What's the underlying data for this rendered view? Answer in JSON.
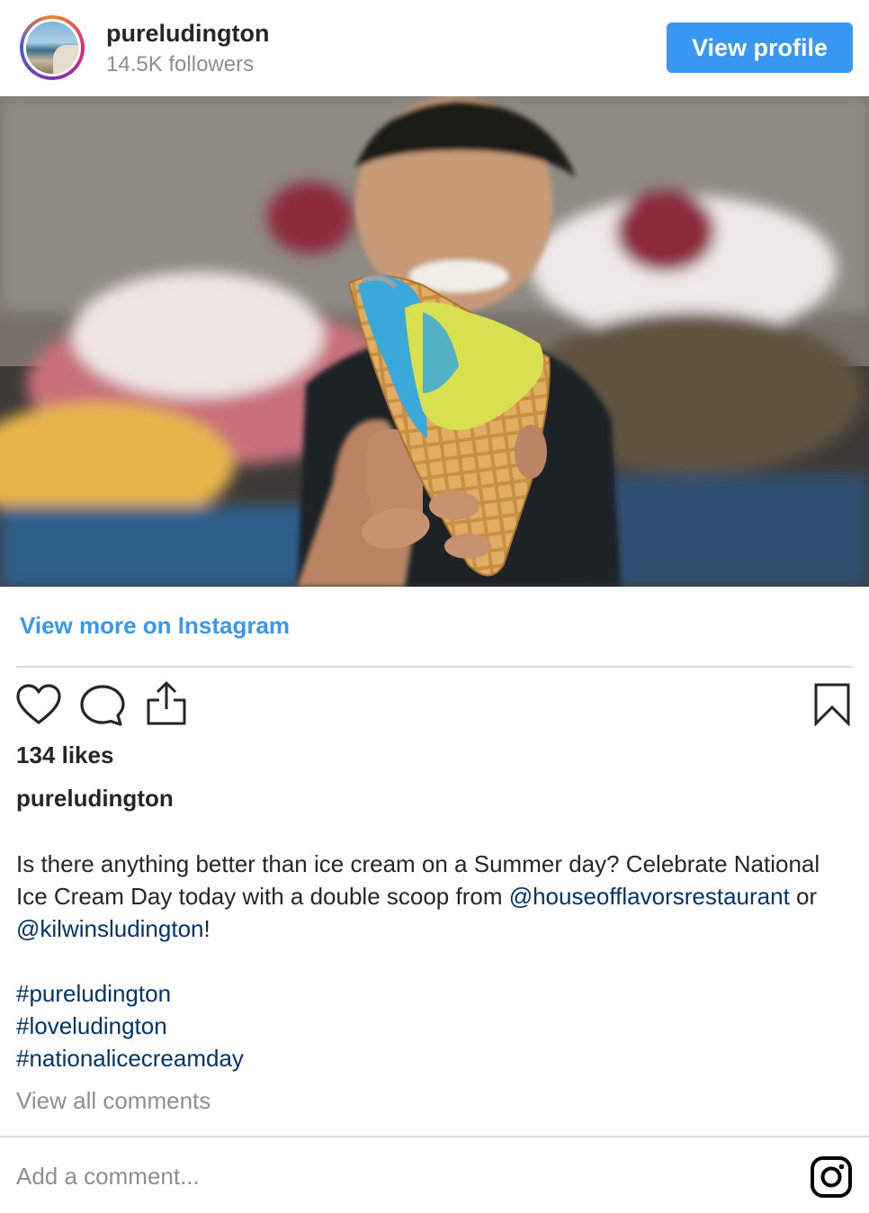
{
  "header": {
    "username": "pureludington",
    "followers": "14.5K followers",
    "view_profile_label": "View profile"
  },
  "post": {
    "image_alt": "Child holding a waffle cone with blue and yellow ice cream",
    "view_more_label": "View more on Instagram",
    "likes": "134 likes",
    "caption_user": "pureludington",
    "caption_part1": "Is there anything better than ice cream on a Summer day? Celebrate National Ice Cream Day today with a double scoop from ",
    "mention1": "@houseofflavorsrestaurant",
    "caption_or": " or ",
    "mention2": "@kilwinsludington",
    "caption_end": "!",
    "hashtags": [
      "#pureludington",
      "#loveludington",
      "#nationalicecreamday"
    ],
    "view_all_comments": "View all comments",
    "add_comment_placeholder": "Add a comment..."
  },
  "icons": {
    "like": "heart-icon",
    "comment": "comment-bubble-icon",
    "share": "share-icon",
    "save": "bookmark-icon",
    "instagram": "instagram-logo-icon"
  },
  "colors": {
    "accent": "#3897f0",
    "link": "#003569",
    "muted": "#8e8e8e",
    "text": "#262626"
  }
}
